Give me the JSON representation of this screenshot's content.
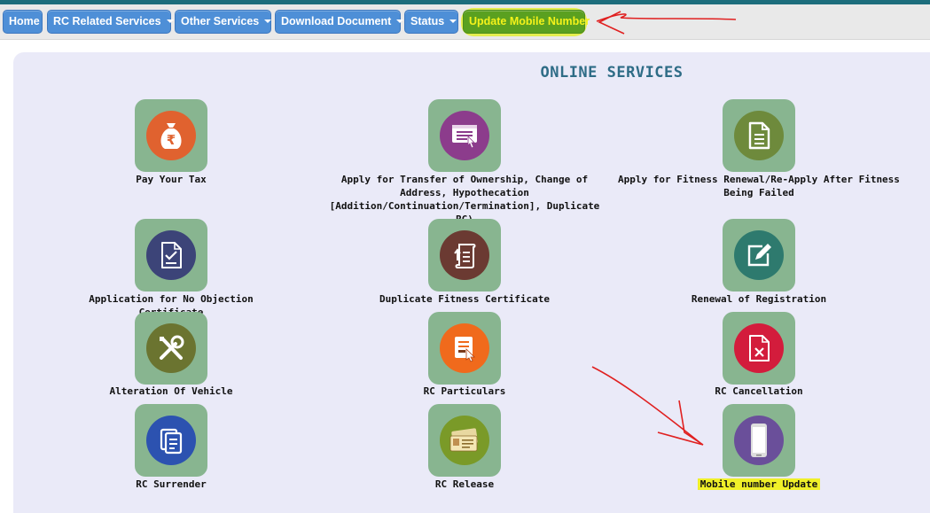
{
  "navbar": {
    "items": [
      {
        "label": "Home",
        "dropdown": false
      },
      {
        "label": "RC Related Services",
        "dropdown": true
      },
      {
        "label": "Other Services",
        "dropdown": true
      },
      {
        "label": "Download Document",
        "dropdown": true
      },
      {
        "label": "Status",
        "dropdown": true
      },
      {
        "label": "Update Mobile Number",
        "dropdown": false,
        "highlighted": true
      }
    ]
  },
  "main": {
    "heading": "ONLINE SERVICES",
    "services": [
      {
        "label": "Pay Your Tax",
        "icon": "rupee-bag-icon",
        "color": "#e0622f"
      },
      {
        "label": "Apply for Transfer of Ownership, Change of Address, Hypothecation [Addition/Continuation/Termination], Duplicate RC)",
        "icon": "web-form-icon",
        "color": "#8c3c8c"
      },
      {
        "label": "Apply for Fitness Renewal/Re-Apply After Fitness Being Failed",
        "icon": "document-icon",
        "color": "#6e8a3c"
      },
      {
        "label": "Application for No Objection Certificate",
        "icon": "checklist-document-icon",
        "color": "#3c4478"
      },
      {
        "label": "Duplicate Fitness Certificate",
        "icon": "scroll-upload-icon",
        "color": "#6b3a32"
      },
      {
        "label": "Renewal of Registration",
        "icon": "edit-pen-icon",
        "color": "#2e7a6e"
      },
      {
        "label": "Alteration Of Vehicle",
        "icon": "tools-icon",
        "color": "#6b7430"
      },
      {
        "label": "RC Particulars",
        "icon": "certificate-cursor-icon",
        "color": "#f06a1c"
      },
      {
        "label": "RC Cancellation",
        "icon": "cancel-document-icon",
        "color": "#d31c3c"
      },
      {
        "label": "RC Surrender",
        "icon": "copy-documents-icon",
        "color": "#2c52b0"
      },
      {
        "label": "RC Release",
        "icon": "rc-cards-icon",
        "color": "#7a9a28"
      },
      {
        "label": "Mobile number Update",
        "icon": "mobile-phone-icon",
        "color": "#6a4f9a",
        "highlighted": true
      }
    ]
  }
}
